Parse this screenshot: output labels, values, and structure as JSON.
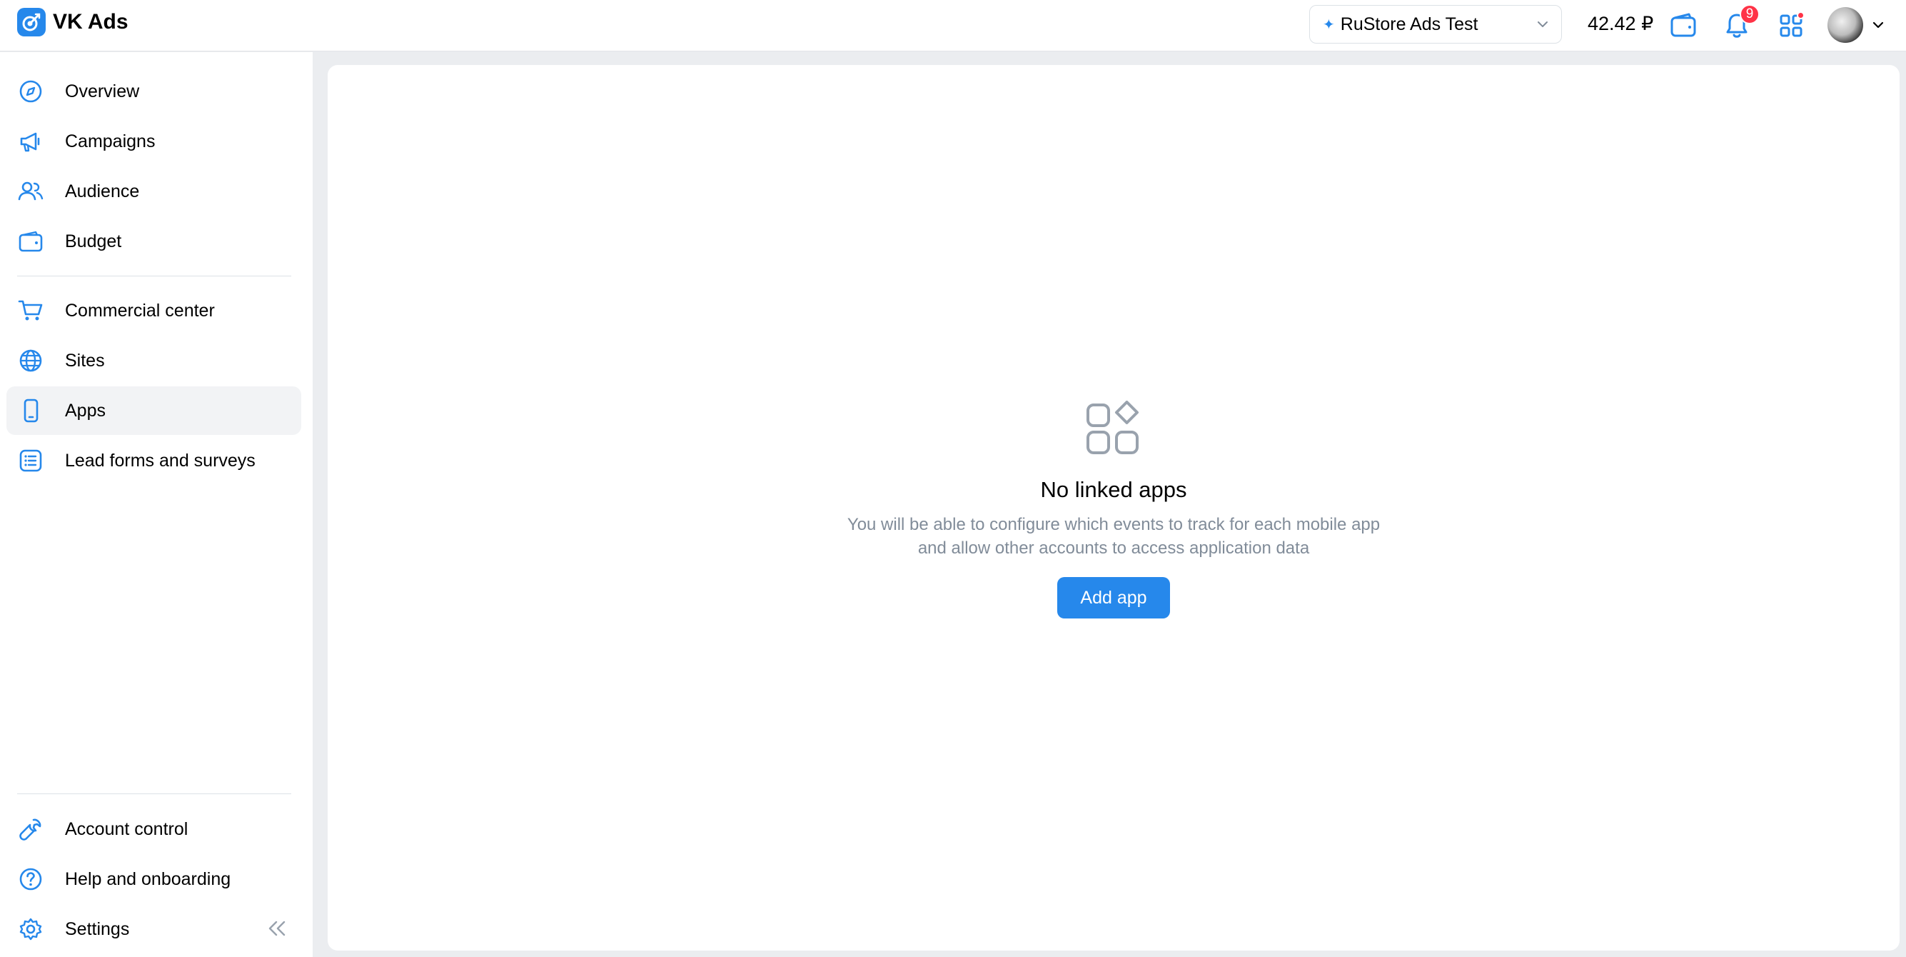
{
  "header": {
    "logo_text": "VK Ads",
    "account_name": "RuStore Ads Test",
    "balance": "42.42 ₽",
    "notifications_count": "9"
  },
  "sidebar": {
    "items": [
      {
        "label": "Overview",
        "icon": "compass-icon"
      },
      {
        "label": "Campaigns",
        "icon": "megaphone-icon"
      },
      {
        "label": "Audience",
        "icon": "users-icon"
      },
      {
        "label": "Budget",
        "icon": "wallet-icon"
      },
      {
        "label": "Commercial center",
        "icon": "cart-icon"
      },
      {
        "label": "Sites",
        "icon": "globe-icon"
      },
      {
        "label": "Apps",
        "icon": "smartphone-icon",
        "active": true
      },
      {
        "label": "Lead forms and surveys",
        "icon": "list-icon"
      }
    ],
    "bottom_items": [
      {
        "label": "Account control",
        "icon": "wrench-icon"
      },
      {
        "label": "Help and onboarding",
        "icon": "question-icon"
      },
      {
        "label": "Settings",
        "icon": "gear-icon"
      }
    ]
  },
  "main": {
    "empty_title": "No linked apps",
    "empty_line1": "You will be able to configure which events to track for each mobile app",
    "empty_line2": "and allow other accounts to access application data",
    "add_button": "Add app"
  },
  "colors": {
    "accent": "#2688eb",
    "badge": "#ff3347",
    "muted_text": "#818c99",
    "page_bg": "#ebedf0"
  }
}
